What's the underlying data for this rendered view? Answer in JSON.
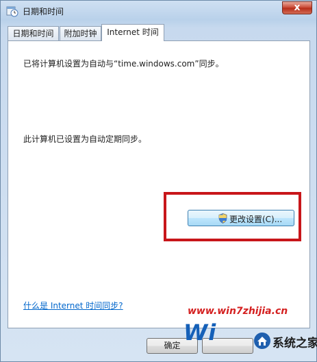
{
  "window": {
    "title": "日期和时间",
    "close_symbol": "x"
  },
  "tabs": [
    {
      "label": "日期和时间",
      "active": false
    },
    {
      "label": "附加时钟",
      "active": false
    },
    {
      "label": "Internet 时间",
      "active": true
    }
  ],
  "internet_time": {
    "sync_message": "已将计算机设置为自动与“time.windows.com”同步。",
    "auto_message": "此计算机已设置为自动定期同步。",
    "change_button_label": "更改设置(C)...",
    "change_button_icon": "uac-shield-icon",
    "help_link": "什么是 Internet 时间同步?"
  },
  "footer": {
    "ok_label": "确定"
  },
  "watermark": {
    "url": "www.win7zhijia.cn",
    "win_text": "Wi",
    "brand_text": "系统之家"
  },
  "colors": {
    "highlight_border": "#c8161a",
    "link": "#0066cc",
    "watermark_url": "#d42020"
  }
}
